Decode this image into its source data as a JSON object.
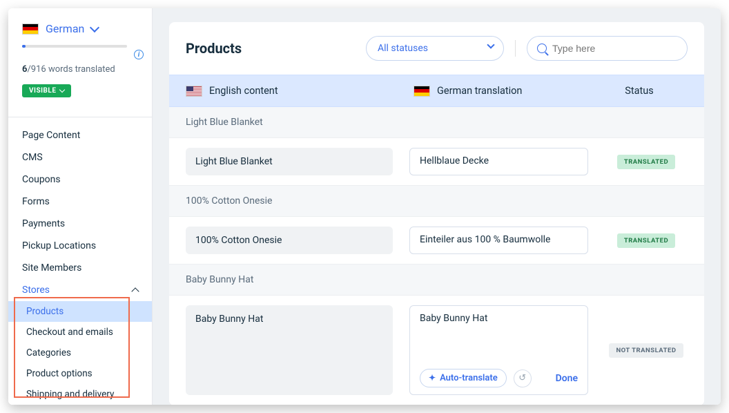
{
  "sidebar": {
    "language": "German",
    "words_done": "6",
    "words_total": "/916 words translated",
    "visible_label": "VISIBLE",
    "nav": [
      "Page Content",
      "CMS",
      "Coupons",
      "Forms",
      "Payments",
      "Pickup Locations",
      "Site Members",
      "Stores"
    ],
    "stores_sub": [
      "Products",
      "Checkout and emails",
      "Categories",
      "Product options",
      "Shipping and delivery"
    ]
  },
  "header": {
    "title": "Products",
    "status_filter": "All statuses",
    "search_placeholder": "Type here"
  },
  "columns": {
    "source": "English content",
    "target": "German translation",
    "status": "Status"
  },
  "sections": [
    {
      "title": "Light Blue Blanket",
      "src": "Light Blue Blanket",
      "tgt": "Hellblaue Decke",
      "status": "TRANSLATED",
      "status_class": "translated"
    },
    {
      "title": "100% Cotton Onesie",
      "src": "100% Cotton Onesie",
      "tgt": "Einteiler aus 100 % Baumwolle",
      "status": "TRANSLATED",
      "status_class": "translated"
    },
    {
      "title": "Baby Bunny Hat",
      "src": "Baby Bunny Hat",
      "tgt": "Baby Bunny Hat",
      "status": "NOT TRANSLATED",
      "status_class": "not-translated",
      "editing": true
    }
  ],
  "actions": {
    "auto_translate": "Auto-translate",
    "done": "Done"
  }
}
